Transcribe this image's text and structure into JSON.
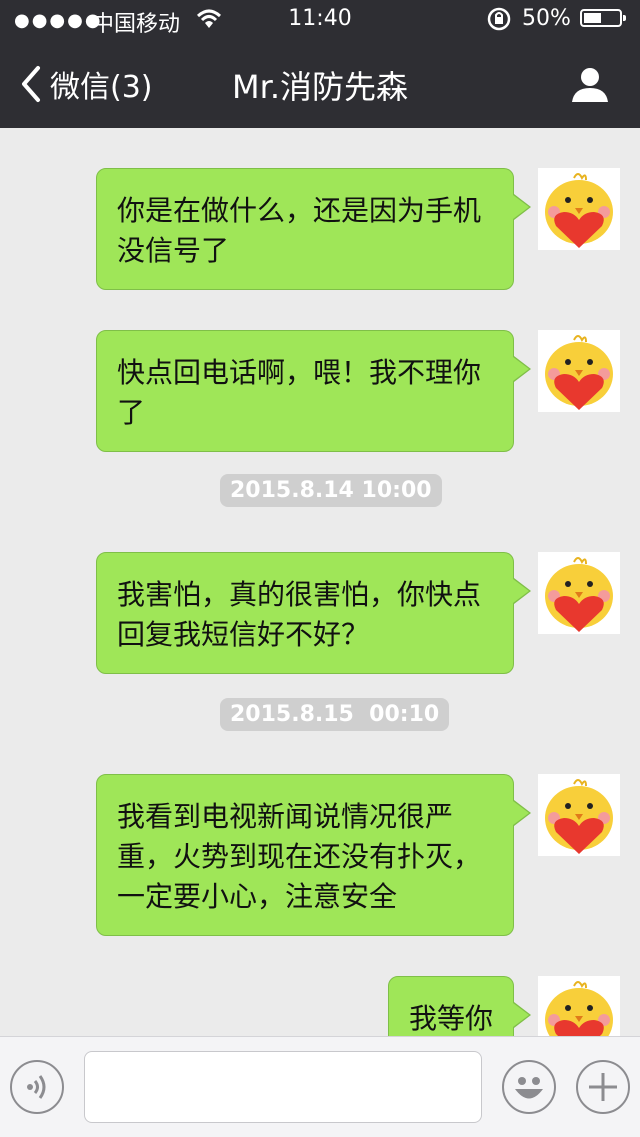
{
  "status_bar": {
    "signal": "●●●●●",
    "carrier": "中国移动",
    "time": "11:40",
    "battery": "50%",
    "battery_level": 0.5
  },
  "nav": {
    "back_label": "微信(3)",
    "title": "Mr.消防先森"
  },
  "messages": [
    {
      "text": "你是在做什么，还是因为手机没信号了"
    },
    {
      "text": "快点回电话啊，喂！我不理你了"
    },
    {
      "text": "我害怕，真的很害怕，你快点回复我短信好不好？"
    },
    {
      "text": "我看到电视新闻说情况很严重，火势到现在还没有扑灭，一定要小心，注意安全"
    },
    {
      "text": "我等你"
    }
  ],
  "timestamps": [
    "2015.8.14 10:00",
    "2015.8.15  00:10"
  ],
  "input": {
    "placeholder": "",
    "value": ""
  },
  "icons": {
    "back": "chevron-left-icon",
    "profile": "profile-icon",
    "voice": "voice-icon",
    "emoji": "emoji-icon",
    "add": "add-icon",
    "avatar": "chick-heart-avatar"
  },
  "colors": {
    "nav_bg": "#2e2e33",
    "chat_bg": "#ebebeb",
    "bubble": "#9fe658",
    "timestamp_bg": "#cfcfcf"
  }
}
